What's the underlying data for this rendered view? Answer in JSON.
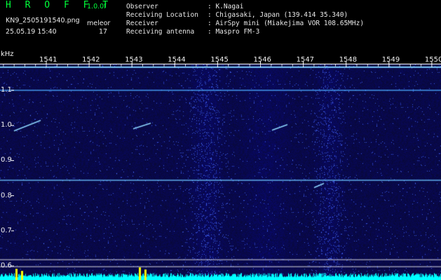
{
  "header": {
    "app_title": "H R O F F T",
    "version": "1.0.0f",
    "filename": "KN9_2505191540.png",
    "datetime": "25.05.19 15:40",
    "mode_label": "meleor",
    "count_value": "17"
  },
  "info": {
    "observer_label": "Observer",
    "observer_value": ": K.Nagai",
    "location_label": "Receiving Location",
    "location_value": ": Chigasaki, Japan (139.414 35.340)",
    "receiver_label": "Receiver",
    "receiver_value": ": AirSpy mini (Miakejima VOR 108.65MHz)",
    "antenna_label": "Receiving antenna",
    "antenna_value": ": Maspro FM-3"
  },
  "axis": {
    "y_unit": "kHz",
    "y_ticks": [
      "1.1",
      "1.0",
      "0.9",
      "0.8",
      "0.7",
      "0.6"
    ],
    "x_ticks": [
      "1541",
      "1542",
      "1543",
      "1544",
      "1545",
      "1546",
      "1547",
      "1548",
      "1549",
      "1550"
    ]
  },
  "colors": {
    "background": "#000000",
    "spectrum_base": "#10106a",
    "carrier_line": "#7cd0ff",
    "bottom_bar": "#00ffff",
    "marker": "#ffff00",
    "header_green": "#00ff3a"
  }
}
